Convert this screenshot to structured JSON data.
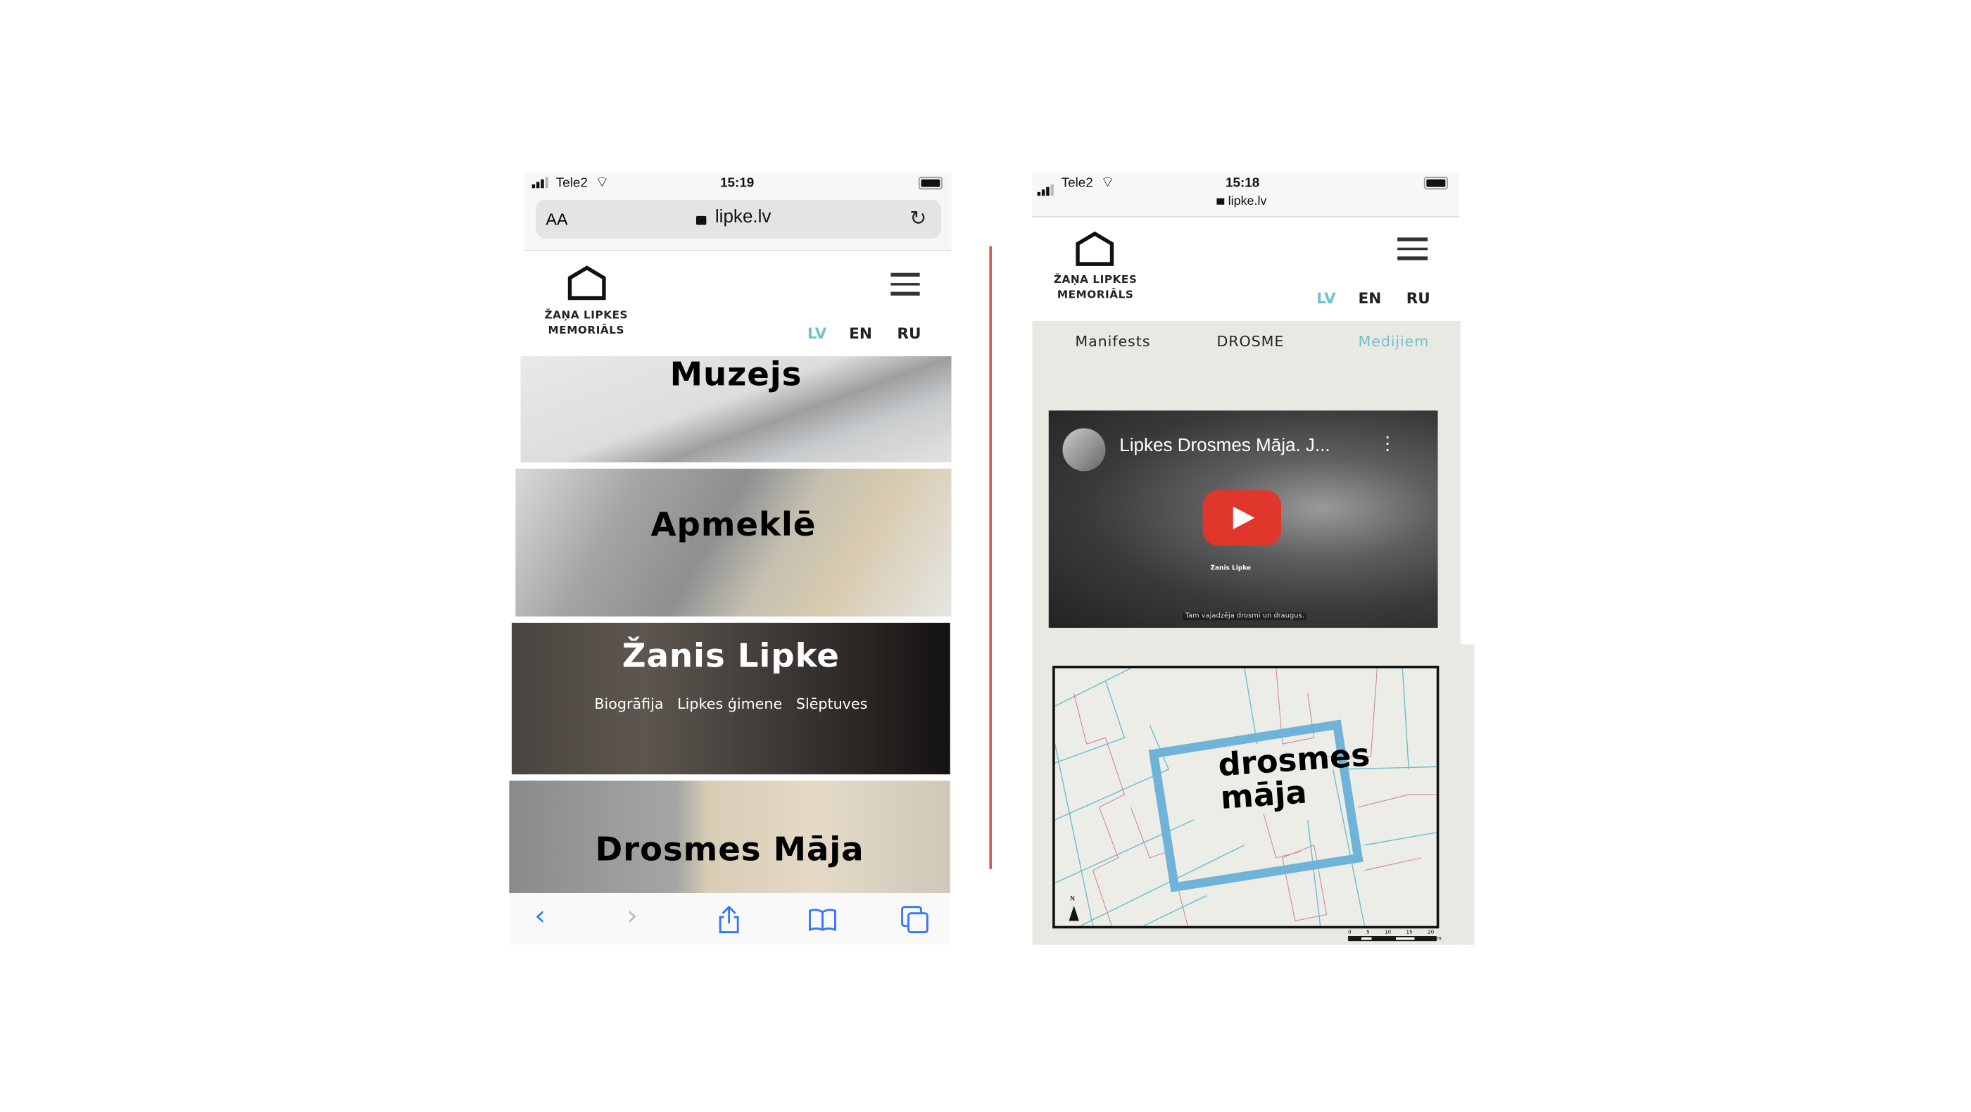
{
  "left_phone": {
    "status": {
      "carrier": "Tele2",
      "time": "15:19"
    },
    "address_bar": {
      "text_size_label": "AA",
      "url": "lipke.lv"
    },
    "logo": {
      "line1": "ŽAŅA LIPKES",
      "line2": "MEMORIĀLS"
    },
    "languages": [
      {
        "label": "LV",
        "active": true
      },
      {
        "label": "EN",
        "active": false
      },
      {
        "label": "RU",
        "active": false
      }
    ],
    "panels": [
      {
        "title": "Muzejs"
      },
      {
        "title": "Apmeklē"
      },
      {
        "title": "Žanis Lipke",
        "links": [
          "Biogrāfija",
          "Lipkes ģimene",
          "Slēptuves"
        ]
      },
      {
        "title": "Drosmes Māja"
      }
    ],
    "toolbar": [
      "back-icon",
      "forward-icon",
      "share-icon",
      "bookmarks-icon",
      "tabs-icon"
    ]
  },
  "right_phone": {
    "status": {
      "carrier": "Tele2",
      "time": "15:18",
      "url": "lipke.lv"
    },
    "logo": {
      "line1": "ŽAŅA LIPKES",
      "line2": "MEMORIĀLS"
    },
    "languages": [
      {
        "label": "LV",
        "active": true
      },
      {
        "label": "EN",
        "active": false
      },
      {
        "label": "RU",
        "active": false
      }
    ],
    "tabs": [
      {
        "label": "Manifests",
        "active": false
      },
      {
        "label": "DROSME",
        "active": false
      },
      {
        "label": "Medijiem",
        "active": true
      }
    ],
    "video": {
      "title": "Lipkes Drosmes Māja. J...",
      "caption_name": "Žanis Lipke",
      "subtitle": "Tam vajadzēja drosmi un draugus."
    },
    "map": {
      "label_line1": "drosmes",
      "label_line2": "māja",
      "north": "N",
      "scale_ticks": [
        "0",
        "5",
        "10",
        "15",
        "20"
      ],
      "scale_unit": "m"
    }
  },
  "colors": {
    "accent": "#6fc3c9",
    "divider": "#d9534f",
    "map_highlight": "#6fb3d8",
    "panel_bg": "#e9e9e4",
    "ios_blue": "#3478f6"
  }
}
